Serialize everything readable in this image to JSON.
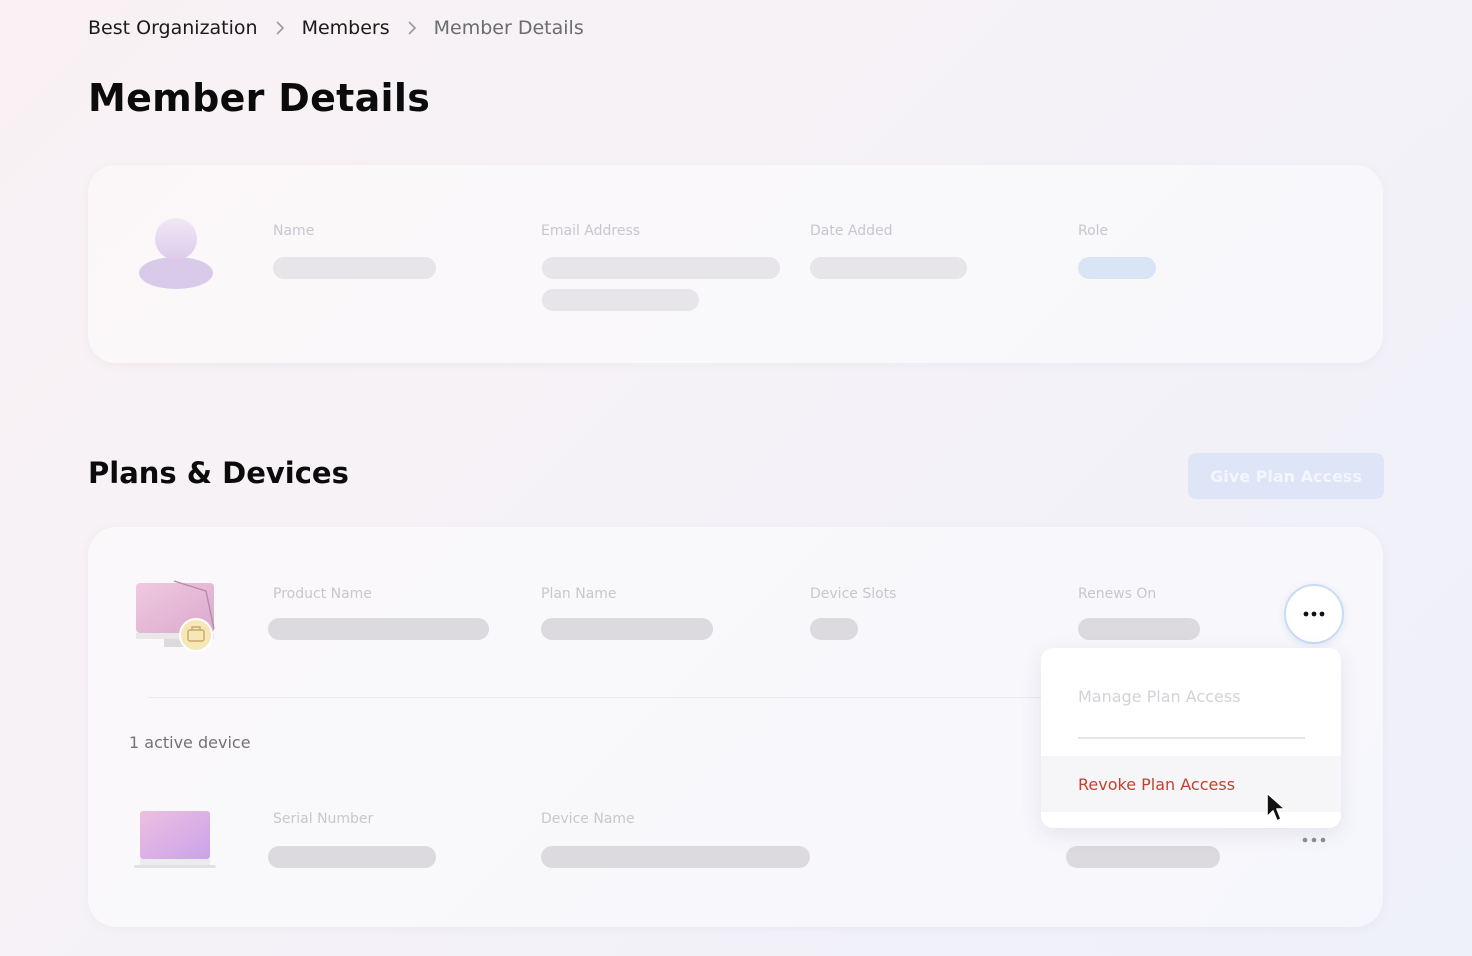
{
  "breadcrumb": {
    "items": [
      "Best Organization",
      "Members",
      "Member Details"
    ]
  },
  "page": {
    "title": "Member Details"
  },
  "member_card": {
    "labels": {
      "name": "Name",
      "email": "Email Address",
      "date_added": "Date Added",
      "role": "Role"
    }
  },
  "plans": {
    "title": "Plans & Devices",
    "give_button": "Give Plan Access",
    "labels": {
      "product_name": "Product Name",
      "plan_name": "Plan Name",
      "device_slots": "Device Slots",
      "renews_on": "Renews On",
      "serial_number": "Serial Number",
      "device_name": "Device Name"
    },
    "active_devices": "1 active device"
  },
  "menu": {
    "manage": "Manage Plan Access",
    "revoke": "Revoke Plan Access"
  },
  "colors": {
    "revoke": "#c2412f",
    "accent_ring": "#c9dcf3"
  }
}
